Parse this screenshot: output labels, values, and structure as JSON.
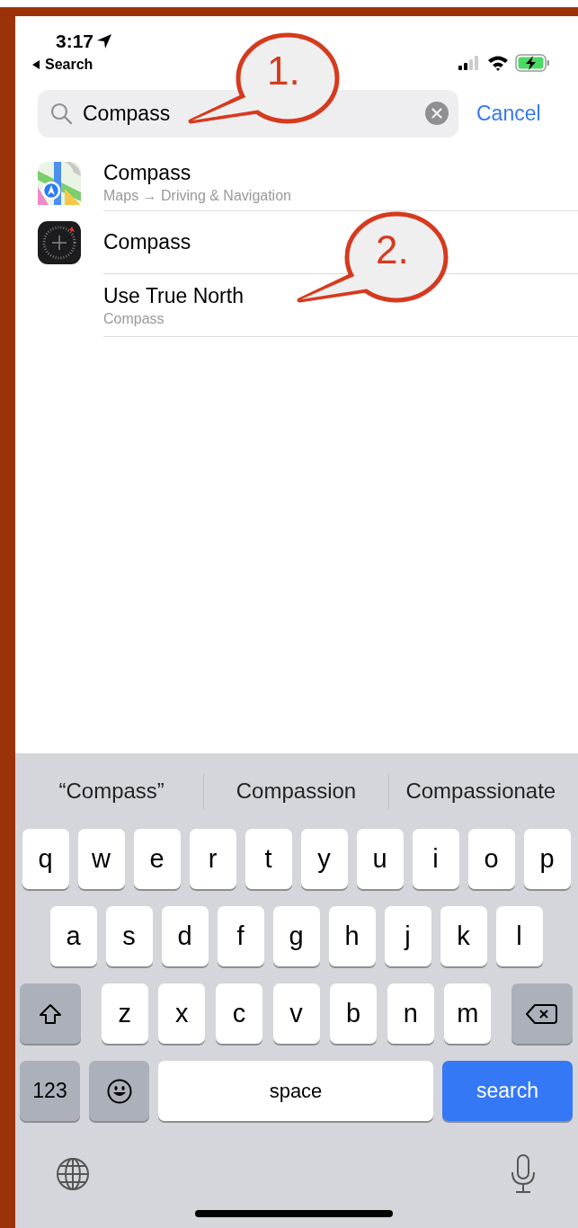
{
  "status_bar": {
    "time": "3:17",
    "back_label": "Search"
  },
  "search": {
    "value": "Compass",
    "cancel": "Cancel"
  },
  "results": [
    {
      "kind": "maps",
      "title": "Compass",
      "subtitle": "Maps → Driving & Navigation"
    },
    {
      "kind": "compass",
      "title": "Compass"
    },
    {
      "kind": "none",
      "title": "Use True North",
      "subtitle": "Compass"
    }
  ],
  "callouts": [
    {
      "label": "1."
    },
    {
      "label": "2."
    }
  ],
  "keyboard": {
    "suggestions": [
      "“Compass”",
      "Compassion",
      "Compassionate"
    ],
    "key_rows": [
      {
        "keys": [
          {
            "kind": "letter",
            "label": "q"
          },
          {
            "kind": "letter",
            "label": "w"
          },
          {
            "kind": "letter",
            "label": "e"
          },
          {
            "kind": "letter",
            "label": "r"
          },
          {
            "kind": "letter",
            "label": "t"
          },
          {
            "kind": "letter",
            "label": "y"
          },
          {
            "kind": "letter",
            "label": "u"
          },
          {
            "kind": "letter",
            "label": "i"
          },
          {
            "kind": "letter",
            "label": "o"
          },
          {
            "kind": "letter",
            "label": "p"
          }
        ]
      },
      {
        "keys": [
          {
            "kind": "letter",
            "label": "a"
          },
          {
            "kind": "letter",
            "label": "s"
          },
          {
            "kind": "letter",
            "label": "d"
          },
          {
            "kind": "letter",
            "label": "f"
          },
          {
            "kind": "letter",
            "label": "g"
          },
          {
            "kind": "letter",
            "label": "h"
          },
          {
            "kind": "letter",
            "label": "j"
          },
          {
            "kind": "letter",
            "label": "k"
          },
          {
            "kind": "letter",
            "label": "l"
          }
        ]
      },
      {
        "keys": [
          {
            "kind": "shift"
          },
          {
            "kind": "letter",
            "label": "z"
          },
          {
            "kind": "letter",
            "label": "x"
          },
          {
            "kind": "letter",
            "label": "c"
          },
          {
            "kind": "letter",
            "label": "v"
          },
          {
            "kind": "letter",
            "label": "b"
          },
          {
            "kind": "letter",
            "label": "n"
          },
          {
            "kind": "letter",
            "label": "m"
          },
          {
            "kind": "delete"
          }
        ]
      },
      {
        "keys": [
          {
            "kind": "numbers",
            "label": "123"
          },
          {
            "kind": "emoji"
          },
          {
            "kind": "space",
            "label": "space"
          },
          {
            "kind": "action",
            "label": "search"
          }
        ]
      }
    ]
  }
}
